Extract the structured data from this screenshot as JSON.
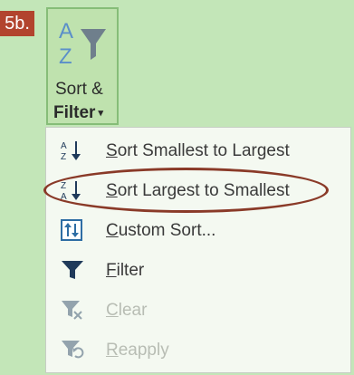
{
  "step": {
    "label": "5b."
  },
  "sort_filter_button": {
    "line1": "Sort &",
    "line2": "Filter",
    "caret": "▾"
  },
  "menu": {
    "items": [
      {
        "label": "Sort Smallest to Largest",
        "icon": "sort-ascending-icon",
        "enabled": true
      },
      {
        "label": "Sort Largest to Smallest",
        "icon": "sort-descending-icon",
        "enabled": true,
        "highlighted": true
      },
      {
        "label": "Custom Sort...",
        "icon": "custom-sort-icon",
        "enabled": true
      },
      {
        "label": "Filter",
        "icon": "filter-icon",
        "enabled": true
      },
      {
        "label": "Clear",
        "icon": "clear-filter-icon",
        "enabled": false
      },
      {
        "label": "Reapply",
        "icon": "reapply-icon",
        "enabled": false
      }
    ]
  },
  "colors": {
    "background": "#c3e6b8",
    "badge": "#b2442e",
    "highlight_oval": "#8a3a28",
    "sort_arrow_red": "#c0392b",
    "icon_dark": "#1f3a5a"
  }
}
